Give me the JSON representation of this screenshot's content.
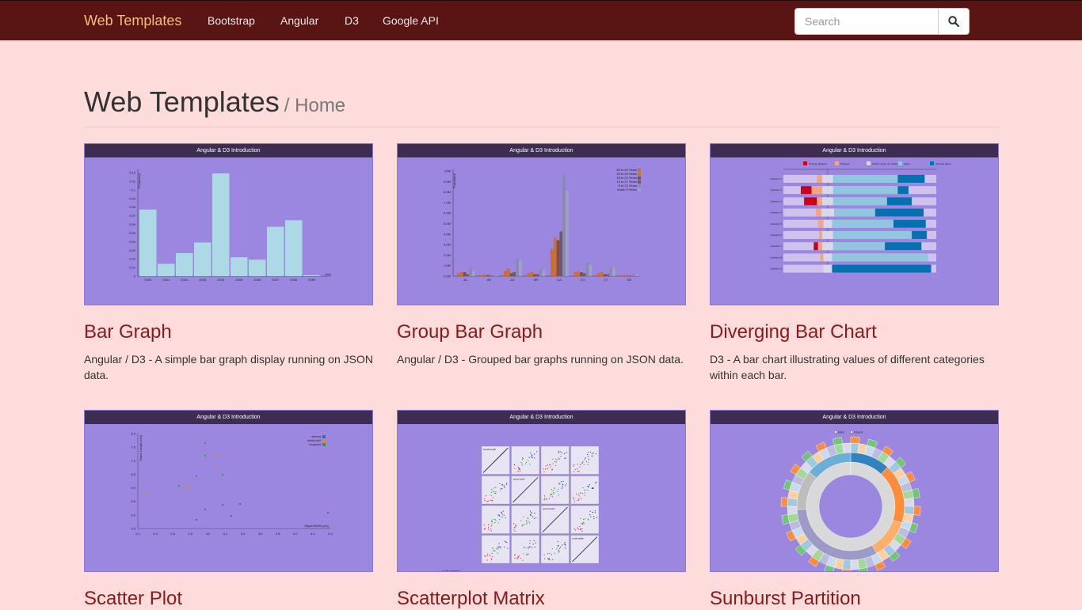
{
  "nav": {
    "brand": "Web Templates",
    "links": [
      "Bootstrap",
      "Angular",
      "D3",
      "Google API"
    ],
    "search_placeholder": "Search"
  },
  "header": {
    "title": "Web Templates",
    "subtitle": "/ Home"
  },
  "cards": [
    {
      "thumb_caption": "Angular & D3 Introduction",
      "title": "Bar Graph",
      "desc": "Angular / D3 - A simple bar graph display running on JSON data."
    },
    {
      "thumb_caption": "Angular & D3 Introduction",
      "title": "Group Bar Graph",
      "desc": "Angular / D3 - Grouped bar graphs running on JSON data."
    },
    {
      "thumb_caption": "Angular & D3 Introduction",
      "title": "Diverging Bar Chart",
      "desc": "D3 - A bar chart illustrating values of different categories within each bar."
    },
    {
      "thumb_caption": "Angular & D3 Introduction",
      "title": "Scatter Plot",
      "desc": ""
    },
    {
      "thumb_caption": "Angular & D3 Introduction",
      "title": "Scatterplot Matrix",
      "desc": ""
    },
    {
      "thumb_caption": "Angular & D3 Introduction",
      "title": "Sunburst Partition",
      "desc": ""
    }
  ],
  "thumbs": {
    "bar": {
      "ylabel": "Frequency",
      "xlabel": "Year",
      "years": [
        "2000",
        "2001",
        "2002",
        "2003",
        "2004",
        "2005",
        "2006",
        "2007",
        "2008",
        "2009"
      ],
      "values": [
        0.081,
        0.015,
        0.028,
        0.041,
        0.125,
        0.023,
        0.02,
        0.06,
        0.068,
        0.001
      ],
      "yticks": [
        "0.12",
        "0.11",
        "0.1",
        "0.09",
        "0.08",
        "0.07",
        "0.06",
        "0.05",
        "0.04",
        "0.03",
        "0.02",
        "0.01",
        "0"
      ]
    },
    "group": {
      "ylabel": "Population",
      "states": [
        "AL",
        "AK",
        "AZ",
        "AR",
        "CA",
        "CO",
        "CT",
        "DE"
      ],
      "legend": [
        "45 to 64 Years",
        "25 to 44 Years",
        "18 to 24 Years",
        "14 to 17 Years",
        "5 to 13 Years",
        "Under 5 Years"
      ],
      "yticks": [
        "10M",
        "9.0M",
        "8.0M",
        "7.0M",
        "6.0M",
        "5.0M",
        "4.0M",
        "3.0M",
        "2.0M",
        "1.0M",
        "0.0M"
      ]
    },
    "diverging": {
      "legend": [
        "Strongly disagree",
        "Disagree",
        "Neither agree nor disagree",
        "Agree",
        "Strongly agree"
      ],
      "rows": [
        "Question 1",
        "Question 2",
        "Question 3",
        "Question 4",
        "Question 5",
        "Question 6",
        "Question 7",
        "Question 8",
        "Question 9"
      ]
    },
    "scatter": {
      "ylabel": "Sepal Length (cm)",
      "xlabel": "Sepal Width (cm)",
      "legend": [
        "setosa",
        "versicolor",
        "virginica"
      ],
      "xticks": [
        "2.2",
        "2.4",
        "2.6",
        "2.8",
        "3.0",
        "3.2",
        "3.4",
        "3.6",
        "3.8",
        "4.0",
        "4.2",
        "4.4"
      ],
      "yticks": [
        "8.0",
        "7.5",
        "7.0",
        "6.5",
        "6.0",
        "5.5",
        "5.0",
        "4.5"
      ]
    },
    "matrix": {
      "traits": [
        "sepal length",
        "sepal width",
        "petal length",
        "petal width"
      ],
      "legend": "iris setosa"
    },
    "sunburst": {
      "options": [
        "Size",
        "Count"
      ]
    }
  },
  "colors": {
    "nav_bg": "#591414",
    "brand": "#f0c277",
    "page_bg": "#fddcdb",
    "thumb_bg": "#9b87e0",
    "card_title": "#8b1a1a"
  }
}
